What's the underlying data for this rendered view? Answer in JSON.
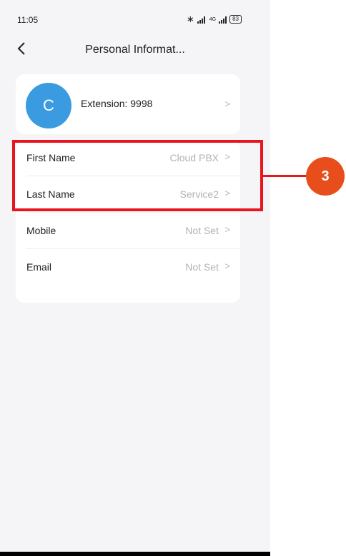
{
  "status_bar": {
    "time": "11:05",
    "network_label": "4G",
    "battery": "83"
  },
  "header": {
    "title": "Personal Informat..."
  },
  "profile": {
    "avatar_letter": "C",
    "extension_label": "Extension: 9998"
  },
  "fields": [
    {
      "label": "First Name",
      "value": "Cloud PBX"
    },
    {
      "label": "Last Name",
      "value": "Service2"
    },
    {
      "label": "Mobile",
      "value": "Not Set"
    },
    {
      "label": "Email",
      "value": "Not Set"
    }
  ],
  "annotation": {
    "step_number": "3"
  },
  "colors": {
    "avatar": "#3a9be0",
    "highlight": "#e8141e",
    "badge": "#e84e1b"
  },
  "icons": {
    "back": "chevron-left-icon",
    "row": "chevron-right-icon"
  }
}
